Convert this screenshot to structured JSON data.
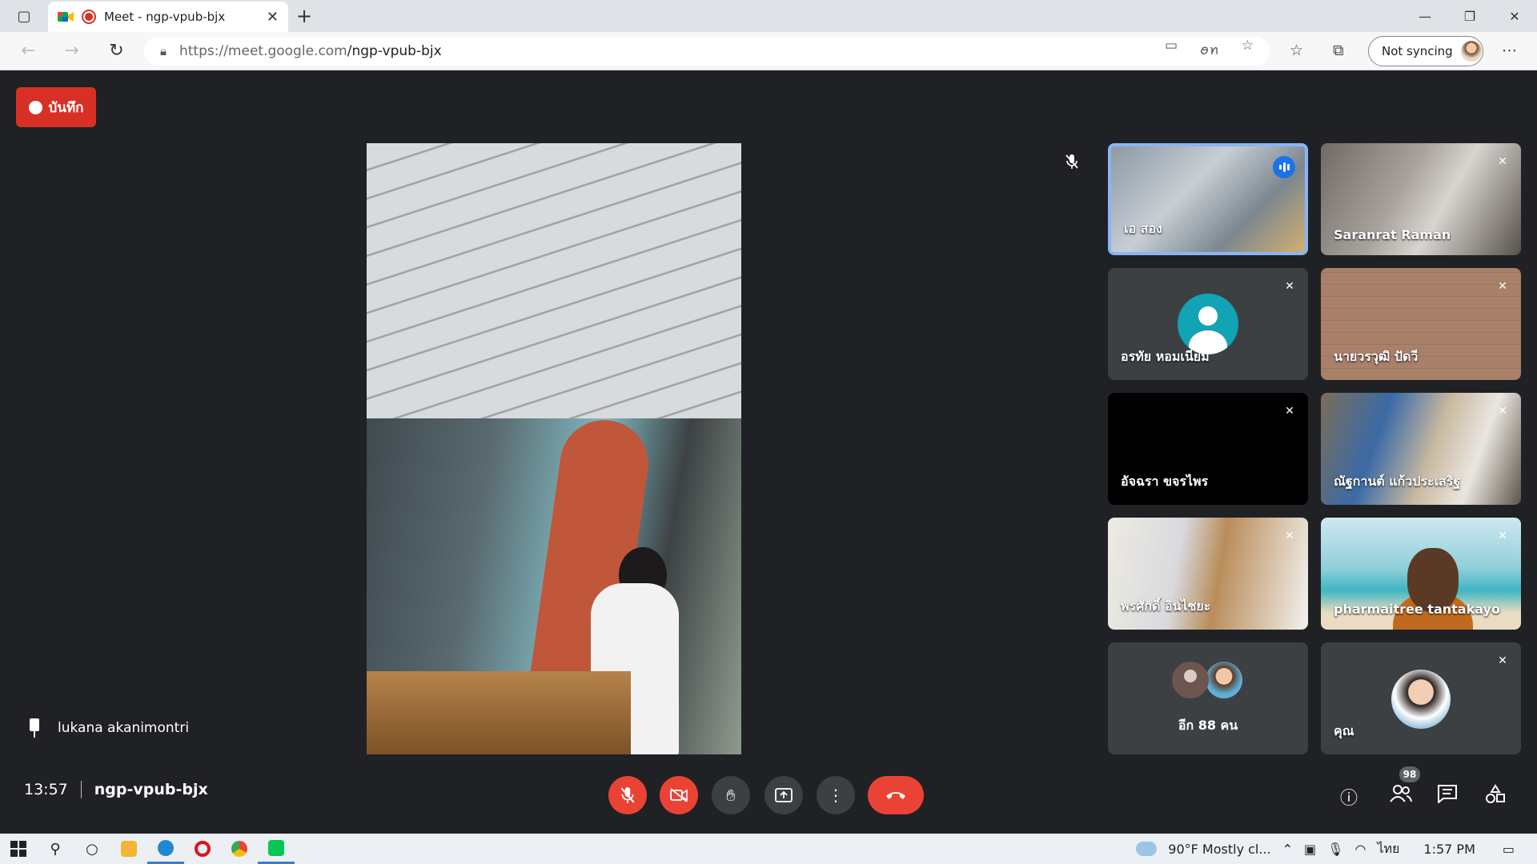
{
  "browser": {
    "tab_title": "Meet - ngp-vpub-bjx",
    "url_host": "https://meet.google.com",
    "url_path": "/ngp-vpub-bjx",
    "not_syncing": "Not syncing",
    "read_aloud_label": "ꪮꪀ"
  },
  "meet": {
    "record_label": "บันทึก",
    "pinned_name": "lukana akanimontri",
    "time": "13:57",
    "meeting_code": "ngp-vpub-bjx",
    "participant_count": "98",
    "tiles": [
      {
        "name": "เอ สอง"
      },
      {
        "name": "Saranrat Raman"
      },
      {
        "name": "อรทัย หอมเนียม"
      },
      {
        "name": "นายวรวุฒิ ปัดวี"
      },
      {
        "name": "อัจฉรา ขจรไพร"
      },
      {
        "name": "ณัฐกานต์ แก้วประเสริฐ"
      },
      {
        "name": "พรศักดิ์ อินไชยะ"
      },
      {
        "name": "pharmaitree tantakayo"
      },
      {
        "name": "อีก 88 คน"
      },
      {
        "name": "คุณ"
      }
    ]
  },
  "taskbar": {
    "weather": "90°F  Mostly cl...",
    "language": "ไทย",
    "time": "1:57 PM"
  },
  "colors": {
    "meet_bg": "#202124",
    "record_red": "#d93025",
    "hangup_red": "#ea4335",
    "active_tile_border": "#8ab4f8"
  }
}
